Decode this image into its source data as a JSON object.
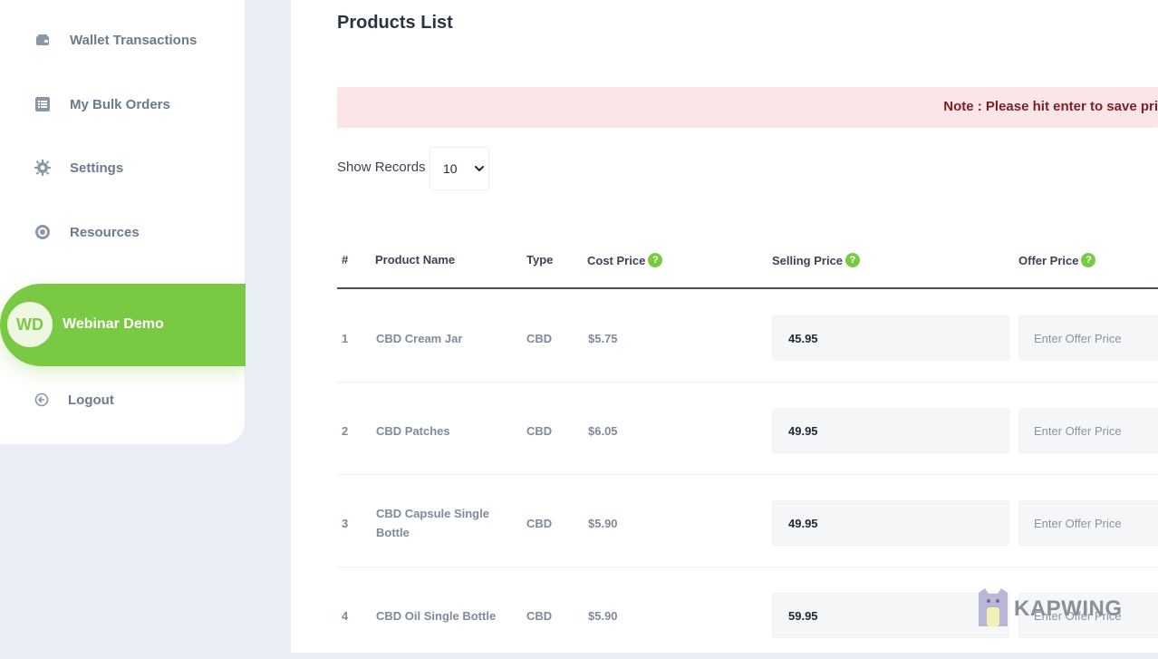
{
  "sidebar": {
    "items": [
      {
        "label": "Wallet Transactions",
        "icon": "wallet-icon"
      },
      {
        "label": "My Bulk Orders",
        "icon": "list-icon"
      },
      {
        "label": "Settings",
        "icon": "gear-icon"
      },
      {
        "label": "Resources",
        "icon": "resources-icon"
      }
    ],
    "profile": {
      "initials": "WD",
      "name": "Webinar Demo"
    },
    "logout": {
      "label": "Logout",
      "icon": "logout-icon"
    }
  },
  "main": {
    "title": "Products List",
    "note": "Note : Please hit enter to save pri",
    "show_records_label": "Show Records",
    "records_value": "10",
    "table": {
      "headers": {
        "index": "#",
        "product_name": "Product Name",
        "type": "Type",
        "cost_price": "Cost Price",
        "selling_price": "Selling Price",
        "offer_price": "Offer Price"
      },
      "rows": [
        {
          "index": "1",
          "name": "CBD Cream Jar",
          "type": "CBD",
          "cost": "$5.75",
          "selling": "45.95",
          "offer_placeholder": "Enter Offer Price"
        },
        {
          "index": "2",
          "name": "CBD Patches",
          "type": "CBD",
          "cost": "$6.05",
          "selling": "49.95",
          "offer_placeholder": "Enter Offer Price"
        },
        {
          "index": "3",
          "name": "CBD Capsule Single Bottle",
          "type": "CBD",
          "cost": "$5.90",
          "selling": "49.95",
          "offer_placeholder": "Enter Offer Price"
        },
        {
          "index": "4",
          "name": "CBD Oil Single Bottle",
          "type": "CBD",
          "cost": "$5.90",
          "selling": "59.95",
          "offer_placeholder": "Enter Offer Price"
        }
      ]
    }
  },
  "watermark": {
    "text": "KAPWING"
  },
  "colors": {
    "accent": "#7ac943",
    "note_bg": "#fbe5e6",
    "note_text": "#7a1f26"
  }
}
